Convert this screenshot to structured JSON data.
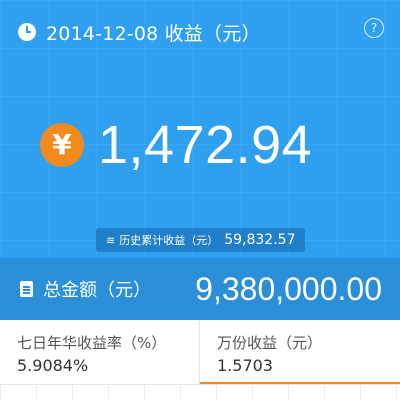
{
  "header": {
    "date_title": "2014-12-08 收益（元）",
    "help_symbol": "?"
  },
  "earnings": {
    "currency_symbol": "¥",
    "amount": "1,472.94"
  },
  "history": {
    "label": "历史累计收益（元）",
    "value": "59,832.57"
  },
  "total": {
    "label": "总金额（元）",
    "value": "9,380,000.00"
  },
  "stats": {
    "annual_yield_label": "七日年华收益率（%）",
    "annual_yield_value": "5.9084%",
    "per_10k_label": "万份收益（元）",
    "per_10k_value": "1.5703"
  },
  "colors": {
    "hero_blue": "#2f9ff0",
    "total_bar_blue": "#2a8fd8",
    "accent_orange": "#f28a1e"
  }
}
